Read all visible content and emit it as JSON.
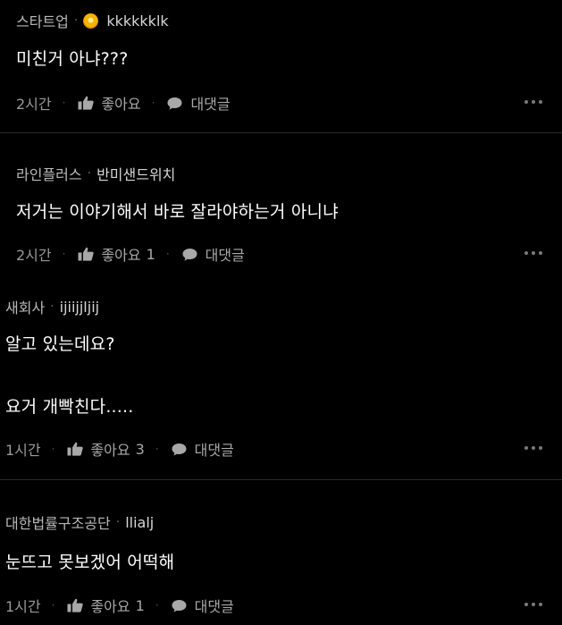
{
  "comments": [
    {
      "company": "스타트업",
      "author": "kkkkkklk",
      "has_badge": true,
      "lines": [
        "미친거 아냐???"
      ],
      "time": "2시간",
      "like_label": "좋아요",
      "like_count": "",
      "reply_label": "대댓글"
    },
    {
      "company": "라인플러스",
      "author": "반미샌드위치",
      "has_badge": false,
      "lines": [
        "저거는 이야기해서 바로 잘라야하는거 아니냐"
      ],
      "time": "2시간",
      "like_label": "좋아요",
      "like_count": "1",
      "reply_label": "대댓글"
    },
    {
      "company": "새회사",
      "author": "ijiijjljij",
      "has_badge": false,
      "lines": [
        "알고 있는데요?",
        "요거 개빡친다....."
      ],
      "time": "1시간",
      "like_label": "좋아요",
      "like_count": "3",
      "reply_label": "대댓글"
    },
    {
      "company": "대한법률구조공단",
      "author": "llialj",
      "has_badge": false,
      "lines": [
        "눈뜨고 못보겠어 어떡해"
      ],
      "time": "1시간",
      "like_label": "좋아요",
      "like_count": "1",
      "reply_label": "대댓글"
    }
  ],
  "colors": {
    "background": "#000000",
    "text": "#ffffff",
    "muted": "#9a9a9a",
    "divider": "#2a2a2a",
    "badge": "#f5b400"
  },
  "icons": {
    "badge": "gold-badge-icon",
    "like": "thumbs-up-icon",
    "reply": "speech-bubble-icon",
    "more": "more-dots-icon"
  }
}
